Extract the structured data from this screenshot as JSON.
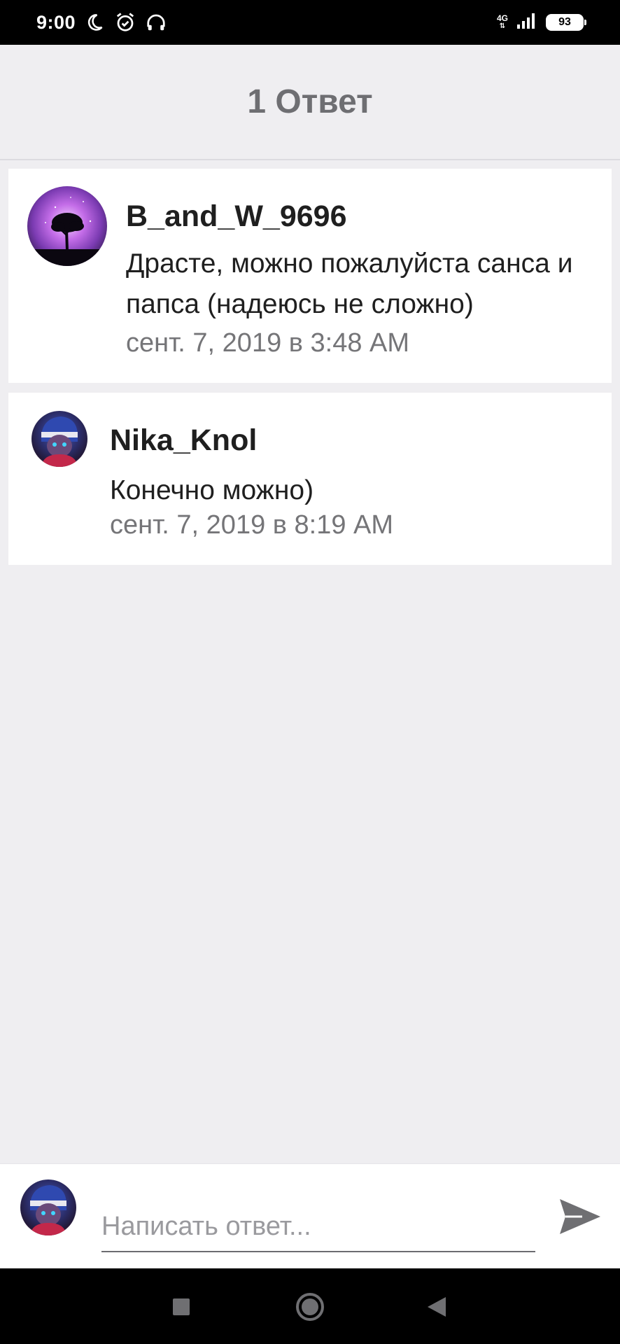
{
  "status_bar": {
    "time": "9:00",
    "network": "4G",
    "battery": "93",
    "icons": [
      "moon-icon",
      "alarm-icon",
      "headphones-icon",
      "signal-icon",
      "battery-icon"
    ]
  },
  "header": {
    "title": "1 Ответ"
  },
  "comments": [
    {
      "username": "B_and_W_9696",
      "message": "Драсте, можно пожалуйста санса и папса (надеюсь не сложно)",
      "timestamp": "сент. 7, 2019 в 3:48 AM",
      "avatar": "tree-avatar"
    },
    {
      "username": "Nika_Knol",
      "message": "Конечно можно)",
      "timestamp": "сент. 7, 2019 в 8:19 AM",
      "avatar": "character-avatar"
    }
  ],
  "reply": {
    "placeholder": "Написать ответ...",
    "value": "",
    "send_icon": "send-icon"
  },
  "nav": {
    "icons": [
      "recent-apps-icon",
      "home-icon",
      "back-icon"
    ]
  },
  "colors": {
    "background": "#efeef1",
    "card": "#ffffff",
    "title": "#6e6e72",
    "text": "#1f1f1f",
    "muted": "#757578"
  }
}
